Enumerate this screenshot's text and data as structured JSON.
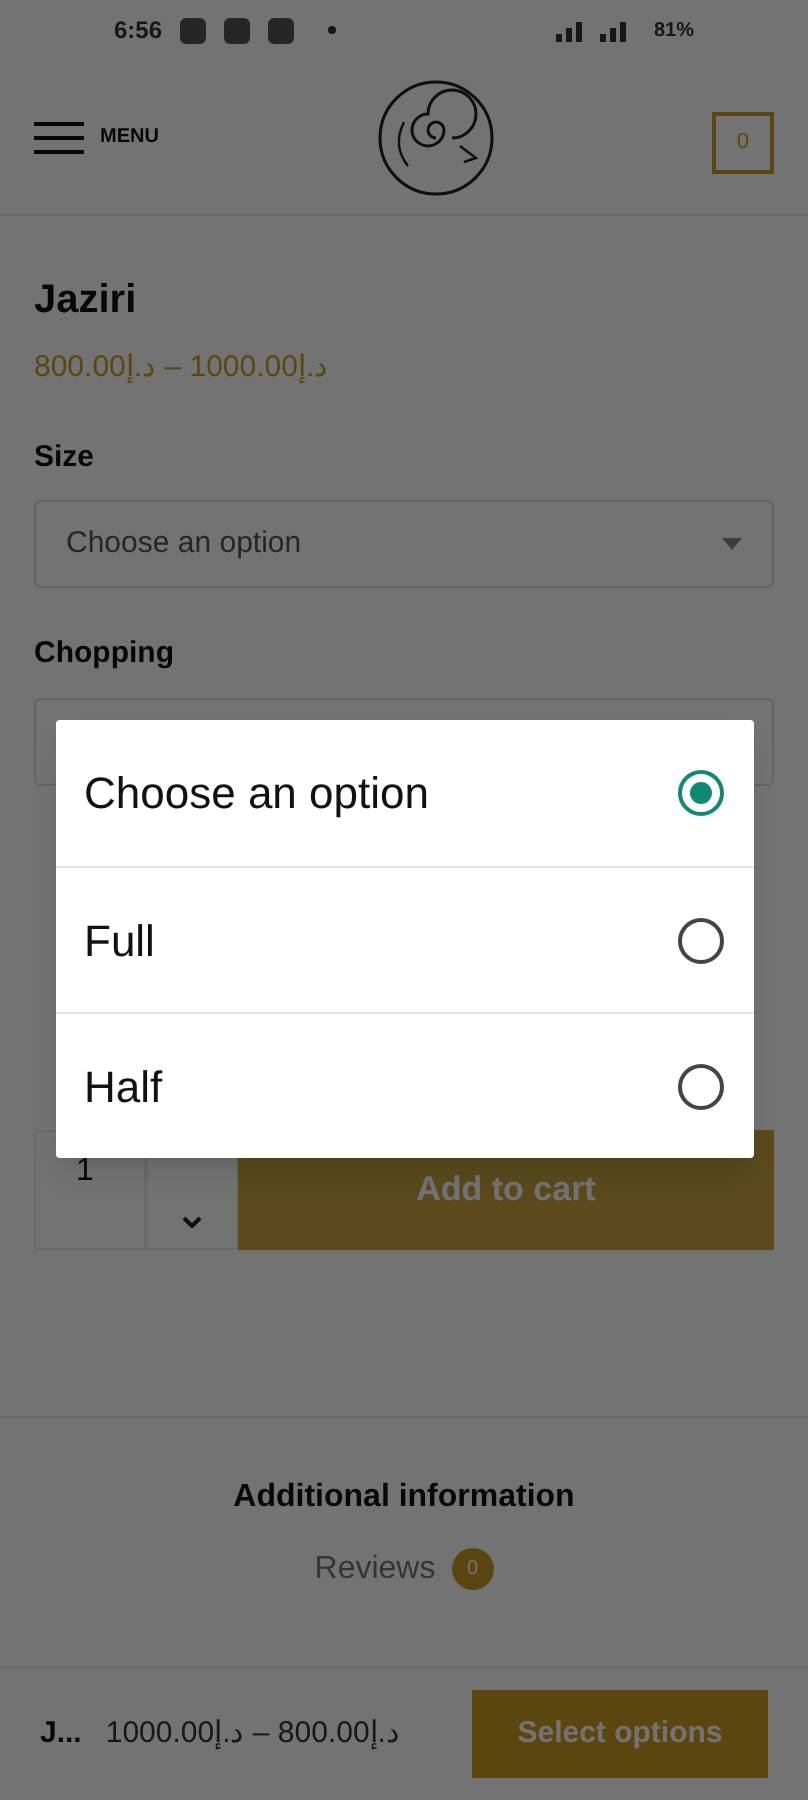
{
  "status_bar": {
    "time": "6:56",
    "battery": "81%"
  },
  "header": {
    "menu_label": "MENU",
    "cart_count": "0"
  },
  "product": {
    "title": "Jaziri",
    "price": "800.00إ.د – 1000.00إ.د"
  },
  "fields": [
    {
      "label": "Size",
      "value": "Choose an option"
    },
    {
      "label": "Chopping"
    }
  ],
  "quantity": {
    "value": "1",
    "button": "Add to cart"
  },
  "tabs": [
    {
      "label": "Additional information",
      "selected": true
    },
    {
      "label": "Reviews",
      "selected": false,
      "count": "0"
    }
  ],
  "sticky_bar": {
    "title": "J...",
    "price": "1000.00إ.د – 800.00إ.د",
    "button": "Select options"
  },
  "dialog": {
    "options": [
      {
        "label": "Choose an option",
        "selected": true
      },
      {
        "label": "Full",
        "selected": false
      },
      {
        "label": "Half",
        "selected": false
      }
    ]
  }
}
